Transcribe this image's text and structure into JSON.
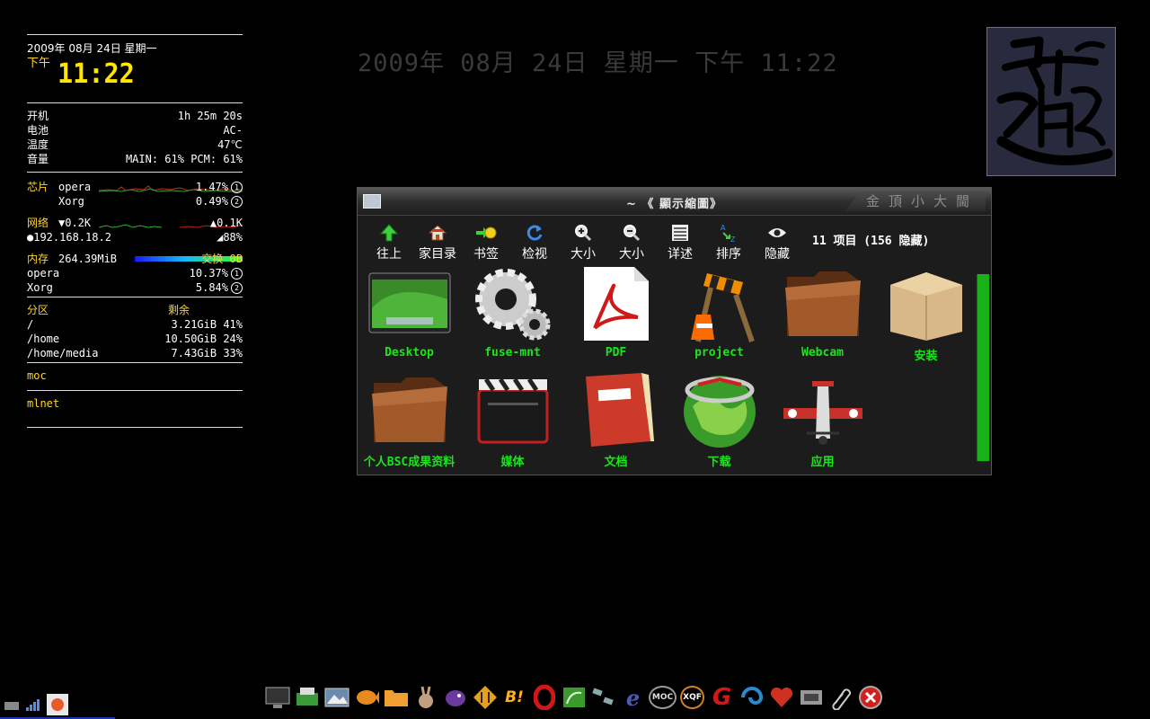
{
  "conky": {
    "date": "2009年 08月 24日 星期一",
    "ampm": "下午",
    "time": "11:22",
    "sys": [
      {
        "label": "开机",
        "value": "1h 25m 20s"
      },
      {
        "label": "电池",
        "value": "AC-"
      },
      {
        "label": "温度",
        "value": "47℃"
      },
      {
        "label": "音量",
        "value": "MAIN: 61% PCM: 61%"
      }
    ],
    "cpu": {
      "label": "芯片",
      "procs": [
        {
          "name": "opera",
          "value": "1.47%",
          "rank": "1"
        },
        {
          "name": "Xorg",
          "value": "0.49%",
          "rank": "2"
        }
      ]
    },
    "net": {
      "label": "网络",
      "down": "▼0.2K",
      "up": "▲0.1K",
      "ip": "●192.168.18.2",
      "signal": "◢88%"
    },
    "mem": {
      "label": "内存",
      "value": "264.39MiB",
      "swap": "交换 0B",
      "procs": [
        {
          "name": "opera",
          "value": "10.37%",
          "rank": "1"
        },
        {
          "name": "Xorg",
          "value": "5.84%",
          "rank": "2"
        }
      ]
    },
    "disk": {
      "label": "分区",
      "free_label": "剩余",
      "rows": [
        {
          "mount": "/",
          "value": "3.21GiB 41%"
        },
        {
          "mount": "/home",
          "value": "10.50GiB 24%"
        },
        {
          "mount": "/home/media",
          "value": "7.43GiB 33%"
        }
      ]
    },
    "moc": "moc",
    "mlnet": "mlnet"
  },
  "bigdate": "2009年 08月 24日 星期一 下午 11:22",
  "fm": {
    "title": "~ 《 顯示縮圖》",
    "right_title": "金頂小大閫",
    "toolbar": [
      {
        "label": "往上",
        "icon": "up-arrow-icon"
      },
      {
        "label": "家目录",
        "icon": "home-icon"
      },
      {
        "label": "书签",
        "icon": "bookmark-icon"
      },
      {
        "label": "检视",
        "icon": "refresh-icon"
      },
      {
        "label": "大小",
        "icon": "zoom-in-icon"
      },
      {
        "label": "大小",
        "icon": "zoom-out-icon"
      },
      {
        "label": "详述",
        "icon": "details-icon"
      },
      {
        "label": "排序",
        "icon": "sort-icon"
      },
      {
        "label": "隐藏",
        "icon": "eye-icon"
      }
    ],
    "count": "11 项目 (156 隐藏)",
    "items": [
      {
        "name": "Desktop",
        "icon": "desktop-folder-icon"
      },
      {
        "name": "fuse-mnt",
        "icon": "gears-icon"
      },
      {
        "name": "PDF",
        "icon": "pdf-icon"
      },
      {
        "name": "project",
        "icon": "construction-icon"
      },
      {
        "name": "Webcam",
        "icon": "leather-folder-icon"
      },
      {
        "name": "安装",
        "icon": "cardboard-box-icon"
      },
      {
        "name": "个人BSC成果资料",
        "icon": "leather-folder-icon"
      },
      {
        "name": "媒体",
        "icon": "clapperboard-icon"
      },
      {
        "name": "文档",
        "icon": "red-binder-icon"
      },
      {
        "name": "下载",
        "icon": "globe-icon"
      },
      {
        "name": "应用",
        "icon": "airplane-icon"
      }
    ]
  },
  "dock": [
    {
      "icon": "monitor-icon"
    },
    {
      "icon": "printer-icon"
    },
    {
      "icon": "image-viewer-icon"
    },
    {
      "icon": "fish-icon"
    },
    {
      "icon": "folder-icon"
    },
    {
      "icon": "rabbit-icon"
    },
    {
      "icon": "bird-icon"
    },
    {
      "icon": "transfer-icon"
    },
    {
      "icon": "b-bang-icon",
      "text": "B!"
    },
    {
      "icon": "opera-icon"
    },
    {
      "icon": "sheet-icon"
    },
    {
      "icon": "satellite-icon"
    },
    {
      "icon": "e-icon",
      "text": "e"
    },
    {
      "icon": "moc-icon",
      "text": "MOC"
    },
    {
      "icon": "xqf-icon",
      "text": "XQF"
    },
    {
      "icon": "g-icon",
      "text": "G"
    },
    {
      "icon": "swirl-icon"
    },
    {
      "icon": "heart-icon"
    },
    {
      "icon": "film-icon"
    },
    {
      "icon": "paperclip-icon"
    },
    {
      "icon": "close-icon"
    }
  ]
}
